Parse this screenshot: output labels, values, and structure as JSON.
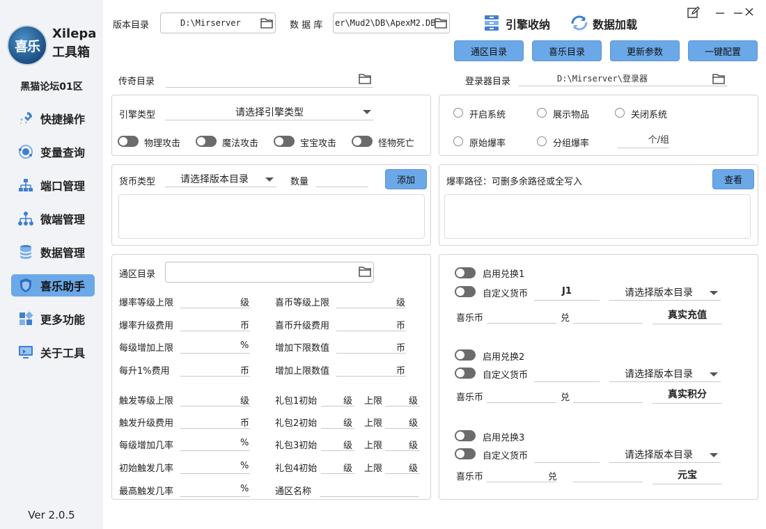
{
  "app": {
    "logo_text": "喜乐",
    "name_line1": "Xilepa",
    "name_line2": "工具箱",
    "forum": "黑猫论坛01区",
    "version": "Ver 2.0.5"
  },
  "nav": [
    {
      "label": "快捷操作",
      "icon": "rocket-icon"
    },
    {
      "label": "变量查询",
      "icon": "atom-icon"
    },
    {
      "label": "端口管理",
      "icon": "network-icon"
    },
    {
      "label": "微端管理",
      "icon": "hierarchy-icon"
    },
    {
      "label": "数据管理",
      "icon": "database-icon"
    },
    {
      "label": "喜乐助手",
      "icon": "shield-icon",
      "active": true
    },
    {
      "label": "更多功能",
      "icon": "grid-icon"
    },
    {
      "label": "关于工具",
      "icon": "monitor-icon"
    }
  ],
  "window_controls": {
    "edit": "edit-icon",
    "minimize": "minimize-icon",
    "maximize": "maximize-icon",
    "close": "close-icon"
  },
  "header": {
    "version_dir_label": "版本目录",
    "version_dir_value": "D:\\Mirserver",
    "db_label": "数 据 库",
    "db_value": "er\\Mud2\\DB\\ApexM2.DB",
    "engine_storage": "引擎收纳",
    "data_load": "数据加载",
    "buttons": [
      "通区目录",
      "喜乐目录",
      "更新参数",
      "一键配置"
    ]
  },
  "legend_dir": {
    "label": "传奇目录",
    "value": ""
  },
  "launcher_dir": {
    "label": "登录器目录",
    "value": "D:\\Mirserver\\登录器"
  },
  "engine": {
    "type_label": "引擎类型",
    "type_placeholder": "请选择引擎类型",
    "toggles": [
      "物理攻击",
      "魔法攻击",
      "宝宝攻击",
      "怪物死亡"
    ]
  },
  "system_options": {
    "row1": [
      "开启系统",
      "展示物品",
      "关闭系统"
    ],
    "row2": [
      "原始爆率",
      "分组爆率"
    ],
    "group_unit": "个/组"
  },
  "currency": {
    "type_label": "货币类型",
    "type_placeholder": "请选择版本目录",
    "qty_label": "数量",
    "add_btn": "添加"
  },
  "drop_path": {
    "label": "爆率路径：可删多余路径或全写入",
    "view_btn": "查看"
  },
  "zone": {
    "dir_label": "通区目录",
    "left_fields": [
      {
        "label": "爆率等级上限",
        "unit": "级"
      },
      {
        "label": "爆率升级费用",
        "unit": "币"
      },
      {
        "label": "每级增加上限",
        "unit": "%"
      },
      {
        "label": "每升1%费用",
        "unit": "币"
      }
    ],
    "right_fields": [
      {
        "label": "喜币等级上限",
        "unit": "级"
      },
      {
        "label": "喜币升级费用",
        "unit": "币"
      },
      {
        "label": "增加下限数值",
        "unit": "币"
      },
      {
        "label": "增加上限数值",
        "unit": "币"
      }
    ],
    "trigger_fields": [
      {
        "label": "触发等级上限",
        "unit": "级"
      },
      {
        "label": "触发升级费用",
        "unit": "币"
      },
      {
        "label": "每级增加几率",
        "unit": "%"
      },
      {
        "label": "初始触发几率",
        "unit": "%"
      },
      {
        "label": "最高触发几率",
        "unit": "%"
      }
    ],
    "gift_fields": [
      {
        "label": "礼包1初始",
        "unit": "级",
        "upper": "上限",
        "upper_unit": "级"
      },
      {
        "label": "礼包2初始",
        "unit": "级",
        "upper": "上限",
        "upper_unit": "级"
      },
      {
        "label": "礼包3初始",
        "unit": "级",
        "upper": "上限",
        "upper_unit": "级"
      },
      {
        "label": "礼包4初始",
        "unit": "级",
        "upper": "上限",
        "upper_unit": "级"
      }
    ],
    "zone_name_label": "通区名称"
  },
  "exchange": [
    {
      "enable_label": "启用兑换1",
      "custom_label": "自定义货币",
      "custom_value": "J1",
      "select": "请选择版本目录",
      "coin_label": "喜乐币",
      "mid": "兑",
      "result": "真实充值"
    },
    {
      "enable_label": "启用兑换2",
      "custom_label": "自定义货币",
      "custom_value": "",
      "select": "请选择版本目录",
      "coin_label": "喜乐币",
      "mid": "兑",
      "result": "真实积分"
    },
    {
      "enable_label": "启用兑换3",
      "custom_label": "自定义货币",
      "custom_value": "",
      "select": "请选择版本目录",
      "coin_label": "喜乐币",
      "mid": "兑",
      "result": "元宝"
    }
  ]
}
